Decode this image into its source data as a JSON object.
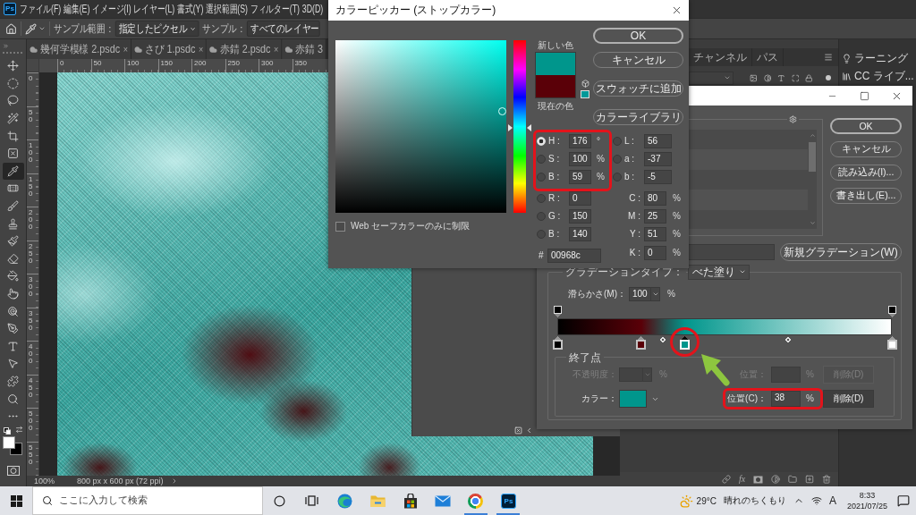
{
  "menu_bar": {
    "logo": "Ps",
    "items": [
      "ファイル(F)",
      "編集(E)",
      "イメージ(I)",
      "レイヤー(L)",
      "書式(Y)",
      "選択範囲(S)",
      "フィルター(T)",
      "3D(D)"
    ]
  },
  "options_bar": {
    "sample_size_label": "サンプル範囲：",
    "sample_size_value": "指定したピクセル",
    "sample_label": "サンプル：",
    "sample_value": "すべてのレイヤー"
  },
  "tabs": [
    {
      "label": "幾何学模様 2.psdc",
      "close": "×",
      "selected": false
    },
    {
      "label": "さび 1.psdc",
      "close": "×",
      "selected": false
    },
    {
      "label": "赤錆 2.psdc",
      "close": "×",
      "selected": false
    },
    {
      "label": "赤錆 3",
      "selected": false
    }
  ],
  "rulers": {
    "horizontal": [
      "0",
      "50",
      "100",
      "150",
      "200",
      "250",
      "300",
      "350"
    ],
    "vertical": [
      "0",
      "50",
      "100",
      "150",
      "200",
      "250",
      "300",
      "350",
      "400",
      "450",
      "500",
      "550"
    ]
  },
  "tools": [
    {
      "kind": "move",
      "selected": false
    },
    {
      "kind": "marquee",
      "selected": false
    },
    {
      "kind": "lasso",
      "selected": false
    },
    {
      "kind": "quick_select",
      "selected": false
    },
    {
      "kind": "crop",
      "selected": false
    },
    {
      "kind": "frame",
      "selected": false
    },
    {
      "kind": "eyedropper",
      "selected": true
    },
    {
      "kind": "healing",
      "selected": false
    },
    {
      "kind": "brush",
      "selected": false
    },
    {
      "kind": "stamp",
      "selected": false
    },
    {
      "kind": "history_brush",
      "selected": false
    },
    {
      "kind": "eraser",
      "selected": false
    },
    {
      "kind": "bucket",
      "selected": false
    },
    {
      "kind": "smudge",
      "selected": false
    },
    {
      "kind": "dodge",
      "selected": false
    },
    {
      "kind": "pen",
      "selected": false
    },
    {
      "kind": "type",
      "selected": false
    },
    {
      "kind": "path_select",
      "selected": false
    },
    {
      "kind": "shape",
      "selected": false
    },
    {
      "kind": "zoom",
      "selected": false
    },
    {
      "kind": "more",
      "selected": false
    }
  ],
  "tool_colors": [
    {
      "kind": "foreground",
      "color": "#ffffff"
    },
    {
      "kind": "background",
      "color": "#000000"
    }
  ],
  "status_bar": {
    "zoom": "100%",
    "document_size": "800 px x 600 px (72 ppi)"
  },
  "panels": {
    "tabs": [
      {
        "label": "チャンネル",
        "selected": false
      },
      {
        "label": "パス",
        "selected": false
      }
    ],
    "side_items": [
      {
        "kind": "learn",
        "label": "ラーニング"
      },
      {
        "kind": "libraries",
        "label": "CC ライブ..."
      }
    ],
    "footer_fx": "fx"
  },
  "color_picker": {
    "title": "カラーピッカー (ストップカラー)",
    "hue_slider": {
      "level": 0.49
    },
    "new_color": {
      "label": "新しい色",
      "color": "#00968c"
    },
    "current_color": {
      "label": "現在の色",
      "color": "#5a0008"
    },
    "websafe_swatch": {
      "color": "#009999"
    },
    "buttons": [
      {
        "label": "OK",
        "default": true
      },
      {
        "label": "キャンセル",
        "default": false
      },
      {
        "label": "スウォッチに追加",
        "default": false
      },
      {
        "label": "カラーライブラリ",
        "default": false
      }
    ],
    "hsb": [
      {
        "label": "H :",
        "value": "176",
        "unit": "°",
        "selected": true
      },
      {
        "label": "S :",
        "value": "100",
        "unit": "%",
        "selected": false
      },
      {
        "label": "B :",
        "value": "59",
        "unit": "%",
        "selected": false
      }
    ],
    "rgb": [
      {
        "label": "R :",
        "value": "0",
        "selected": false
      },
      {
        "label": "G :",
        "value": "150",
        "selected": false
      },
      {
        "label": "B :",
        "value": "140",
        "selected": false
      }
    ],
    "lab": [
      {
        "label": "L :",
        "value": "56",
        "selected": false
      },
      {
        "label": "a :",
        "value": "-37",
        "selected": false
      },
      {
        "label": "b :",
        "value": "-5",
        "selected": false
      }
    ],
    "cmyk": [
      {
        "label": "C :",
        "value": "80",
        "unit": "%"
      },
      {
        "label": "M :",
        "value": "25",
        "unit": "%"
      },
      {
        "label": "Y :",
        "value": "51",
        "unit": "%"
      },
      {
        "label": "K :",
        "value": "0",
        "unit": "%"
      }
    ],
    "hex": {
      "label": "#",
      "value": "00968c"
    },
    "web_only": {
      "label": "Web セーフカラーのみに制限",
      "checked": false
    }
  },
  "gradient_editor": {
    "buttons": [
      {
        "label": "OK",
        "default": true
      },
      {
        "label": "キャンセル",
        "default": false
      },
      {
        "label": "読み込み(I)...",
        "default": false
      },
      {
        "label": "書き出し(E)...",
        "default": false
      }
    ],
    "new_button": "新規グラデーション(W)",
    "type": {
      "label": "グラデーションタイプ：",
      "value": "べた塗り"
    },
    "smoothness": {
      "label": "滑らかさ(M)：",
      "value": "100",
      "unit": "%"
    },
    "opacity_stops": [
      {
        "level": 0
      },
      {
        "level": 1
      }
    ],
    "color_stops": [
      {
        "level": 0,
        "color": "#000000",
        "selected": false
      },
      {
        "level": 0.25,
        "color": "#5a0008",
        "selected": false
      },
      {
        "level": 0.38,
        "color": "#00968c",
        "selected": true
      },
      {
        "level": 1,
        "color": "#ffffff",
        "selected": false
      }
    ],
    "midpoints": [
      {
        "level": 0.315
      },
      {
        "level": 0.69
      }
    ],
    "stop_settings": {
      "title": "終了点",
      "opacity": {
        "label": "不透明度：",
        "unit": "%",
        "position_label": "位置：",
        "position_unit": "%",
        "delete": "削除(D)",
        "disabled": true
      },
      "color": {
        "label": "カラー：",
        "color": "#00968c",
        "position_label": "位置(C)：",
        "position_value": "38",
        "position_unit": "%",
        "delete": "削除(D)",
        "disabled": false
      }
    }
  },
  "annotations": {
    "hsb_frame": true,
    "stop_circle": true,
    "position_frame": true,
    "arrow": true
  },
  "taskbar": {
    "search_placeholder": "ここに入力して検索",
    "apps": [
      {
        "kind": "edge",
        "running": false
      },
      {
        "kind": "explorer",
        "running": false
      },
      {
        "kind": "store",
        "running": false
      },
      {
        "kind": "mail",
        "running": false
      },
      {
        "kind": "chrome",
        "running": true
      },
      {
        "kind": "photoshop",
        "label": "Ps",
        "running": true
      }
    ],
    "weather": {
      "temp": "29°C",
      "text": "晴れのちくもり"
    },
    "ime": "A",
    "time": "8:33",
    "date": "2021/07/25"
  }
}
